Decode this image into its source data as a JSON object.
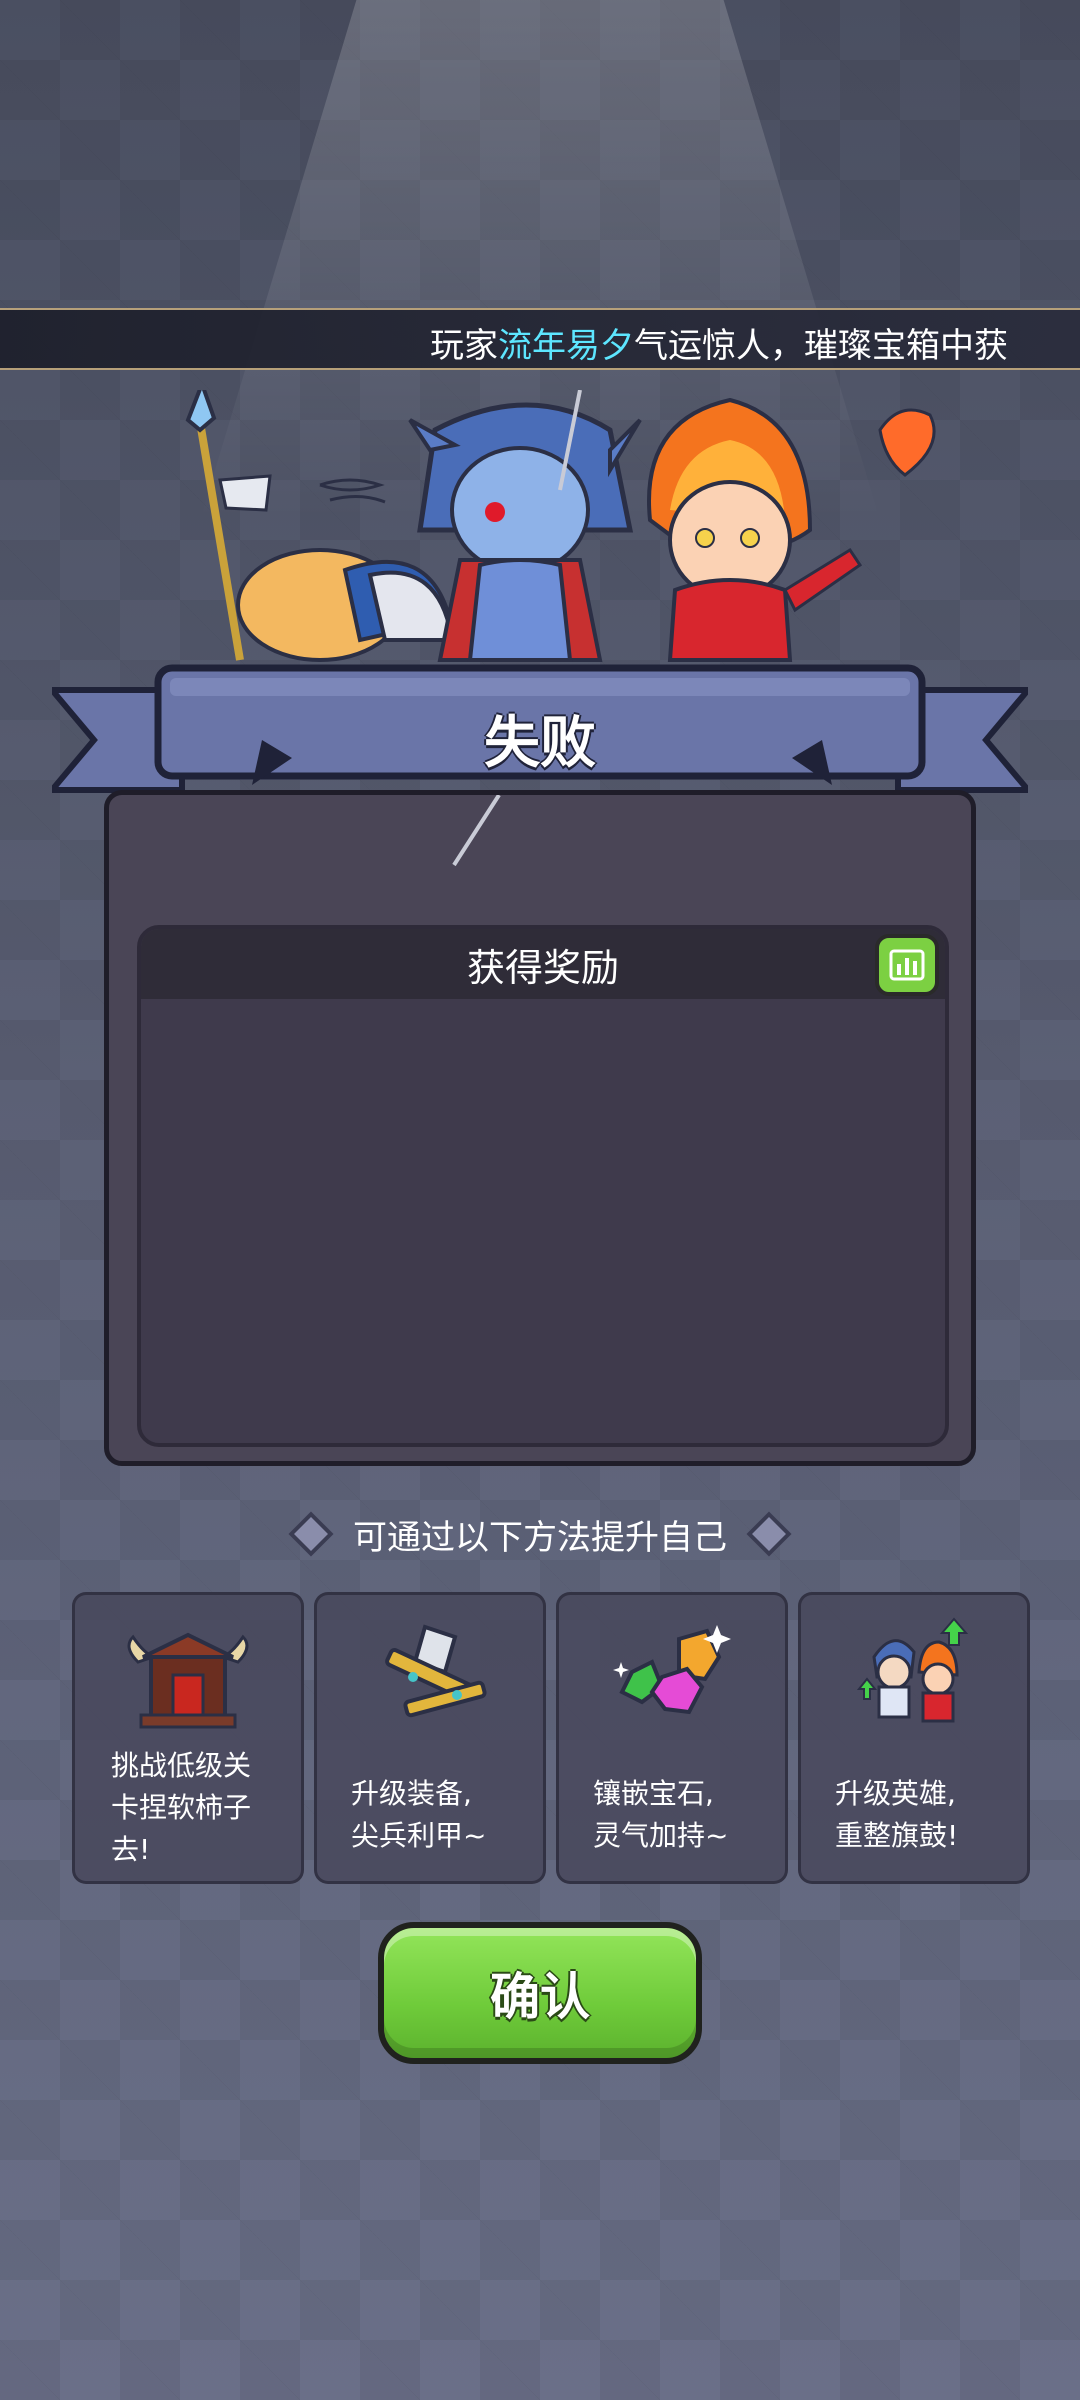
{
  "marquee": {
    "prefix": "玩家",
    "player_name": "流年易夕",
    "suffix": "气运惊人，璀璨宝箱中获"
  },
  "result": {
    "title": "失败"
  },
  "rewards": {
    "header": "获得奖励"
  },
  "hint": {
    "text": "可通过以下方法提升自己"
  },
  "tips": [
    {
      "icon": "gate-icon",
      "text": "挑战低级关\n卡捏软柿子\n去!"
    },
    {
      "icon": "equipment-icon",
      "text": "升级装备,\n尖兵利甲~"
    },
    {
      "icon": "gem-icon",
      "text": "镶嵌宝石,\n灵气加持~"
    },
    {
      "icon": "hero-upgrade-icon",
      "text": "升级英雄,\n重整旗鼓!"
    }
  ],
  "confirm": {
    "label": "确认"
  },
  "colors": {
    "highlight": "#5de6ff",
    "confirm_green": "#6fcb3a",
    "banner_blue": "#6a75a8"
  }
}
